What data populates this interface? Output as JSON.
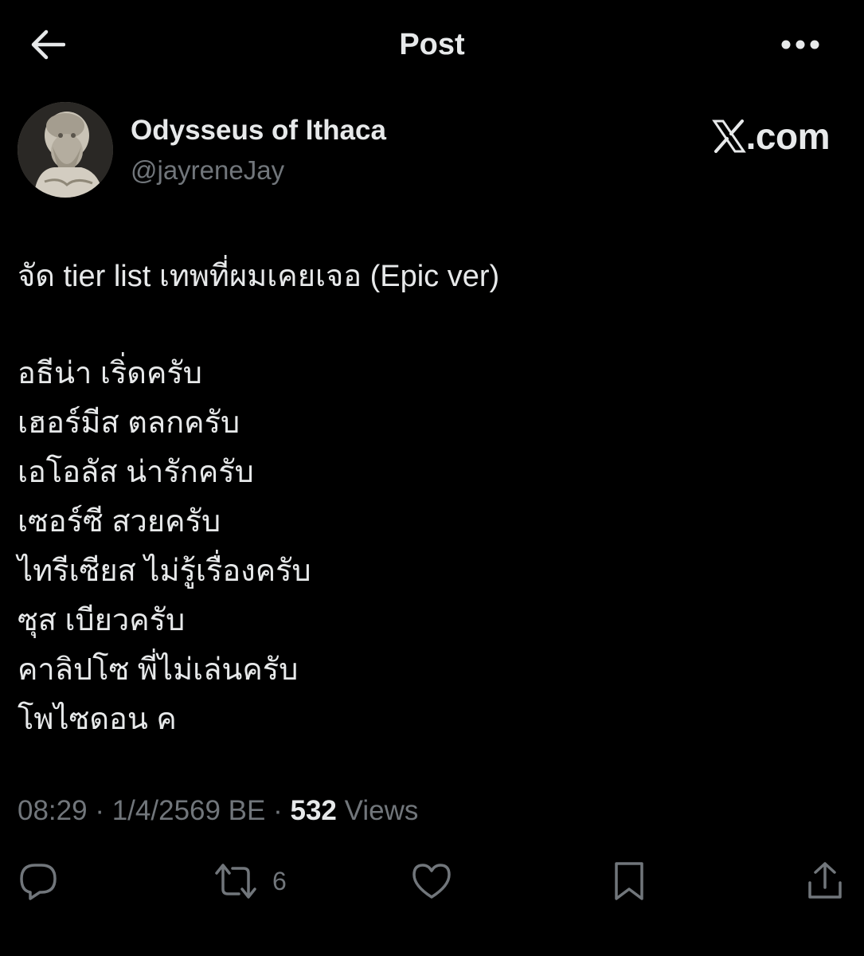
{
  "header": {
    "title": "Post",
    "back_icon": "arrow-left-icon",
    "more_icon": "more-horizontal-icon"
  },
  "author": {
    "display_name": "Odysseus of Ithaca",
    "handle": "@jayreneJay",
    "avatar_icon": "avatar-statue-image"
  },
  "watermark": {
    "text": ".com",
    "logo_icon": "x-logo-icon"
  },
  "post": {
    "title_line": "จัด tier list เทพที่ผมเคยเจอ (Epic ver)",
    "lines": [
      "อธีน่า เริ่ดครับ",
      "เฮอร์มีส ตลกครับ",
      "เอโอลัส น่ารักครับ",
      "เซอร์ซี สวยครับ",
      "ไทรีเซียส ไม่รู้เรื่องครับ",
      "ซุส เบียวครับ",
      "คาลิปโซ พี่ไม่เล่นครับ",
      "โพไซดอน ค"
    ]
  },
  "meta": {
    "time": "08:29",
    "separator": "·",
    "date": "1/4/2569 BE",
    "views_count": "532",
    "views_label": "Views"
  },
  "actions": {
    "reply_icon": "reply-icon",
    "repost_icon": "repost-icon",
    "repost_count": "6",
    "like_icon": "heart-icon",
    "bookmark_icon": "bookmark-icon",
    "share_icon": "share-icon"
  },
  "colors": {
    "background": "#000000",
    "text_primary": "#e7e9ea",
    "text_secondary": "#71767b"
  }
}
